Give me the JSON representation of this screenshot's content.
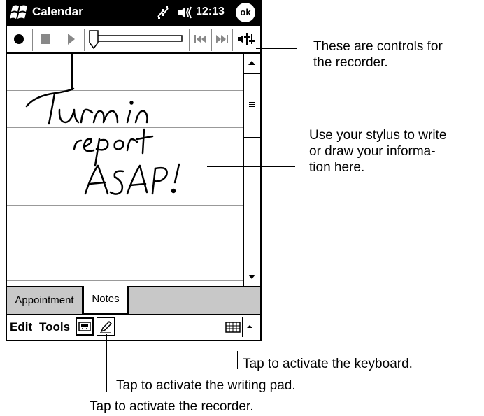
{
  "titlebar": {
    "app_title": "Calendar",
    "time": "12:13",
    "ok_label": "ok"
  },
  "tabs": [
    {
      "label": "Appointment"
    },
    {
      "label": "Notes"
    }
  ],
  "menubar": {
    "edit": "Edit",
    "tools": "Tools"
  },
  "icons": {
    "start": "windows-flag-icon",
    "connectivity": "connectivity-icon",
    "speaker": "speaker-icon",
    "record": "record-icon",
    "stop": "stop-icon",
    "play": "play-icon",
    "volume_slider": "volume-slider",
    "skip_back": "skip-back-icon",
    "skip_forward": "skip-forward-icon",
    "volume": "volume-icon",
    "scroll_up": "scroll-up-icon",
    "scroll_down": "scroll-down-icon",
    "recorder": "recorder-icon",
    "writing_pad": "pen-icon",
    "keyboard": "keyboard-icon",
    "input_menu": "input-arrow-icon"
  },
  "handwriting": {
    "line1": "Turn in",
    "line2": "report",
    "line3": "ASAP!"
  },
  "callouts": {
    "recorder_controls": [
      "These are controls for",
      "the recorder."
    ],
    "stylus": [
      "Use your stylus to write",
      "or draw your informa-",
      "tion here."
    ],
    "keyboard": "Tap to activate the keyboard.",
    "writing_pad": "Tap to activate the writing pad.",
    "recorder": "Tap to activate the recorder."
  },
  "colors": {
    "titlebar_bg": "#000000",
    "tab_bg": "#c8c8c8",
    "rule_line": "#999999"
  }
}
